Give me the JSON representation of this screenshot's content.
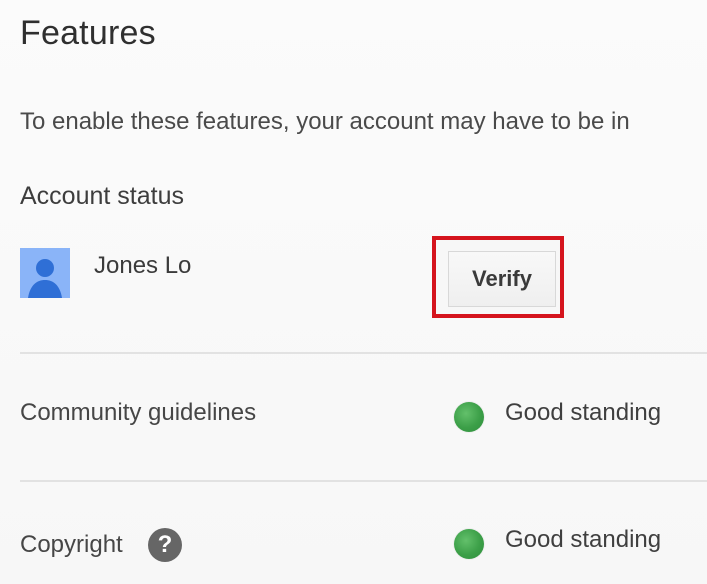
{
  "header": {
    "title": "Features"
  },
  "description": "To enable these features, your account may have to be in",
  "account": {
    "section_label": "Account status",
    "user_name": "Jones Lo",
    "verify_label": "Verify"
  },
  "rows": [
    {
      "label": "Community guidelines",
      "status": "Good standing",
      "status_color": "#3c9f48"
    },
    {
      "label": "Copyright",
      "help_icon": "?",
      "status": "Good standing",
      "status_color": "#3c9f48"
    }
  ],
  "colors": {
    "highlight_border": "#d5141d",
    "avatar_background": "#8ab4f8",
    "avatar_figure": "#2f6fd6"
  },
  "icons": {
    "avatar": "person-icon",
    "help": "help-icon",
    "status": "status-dot-icon"
  }
}
